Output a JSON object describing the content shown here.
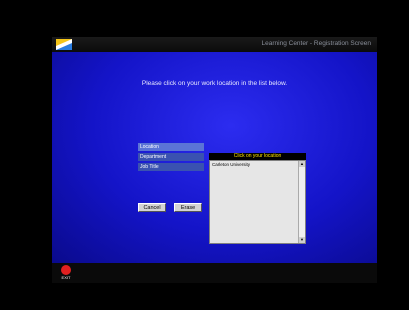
{
  "window": {
    "title": "Learning Center - Registration Screen"
  },
  "main": {
    "instruction": "Please click on your work location in the list below."
  },
  "fields": [
    {
      "label": "Location",
      "active": true
    },
    {
      "label": "Department",
      "active": false
    },
    {
      "label": "Job Title",
      "active": false
    }
  ],
  "buttons": {
    "cancel_label": "Cancel",
    "erase_label": "Erase"
  },
  "picker": {
    "header": "Click on your location",
    "items": [
      "Carleton University"
    ]
  },
  "bottom": {
    "exit_label": "EXIT"
  },
  "colors": {
    "accent_blue": "#1414c8",
    "header_yellow": "#ffe400",
    "exit_red": "#e02020"
  },
  "icons": {
    "logo": "logo-icon",
    "exit": "exit-icon"
  }
}
